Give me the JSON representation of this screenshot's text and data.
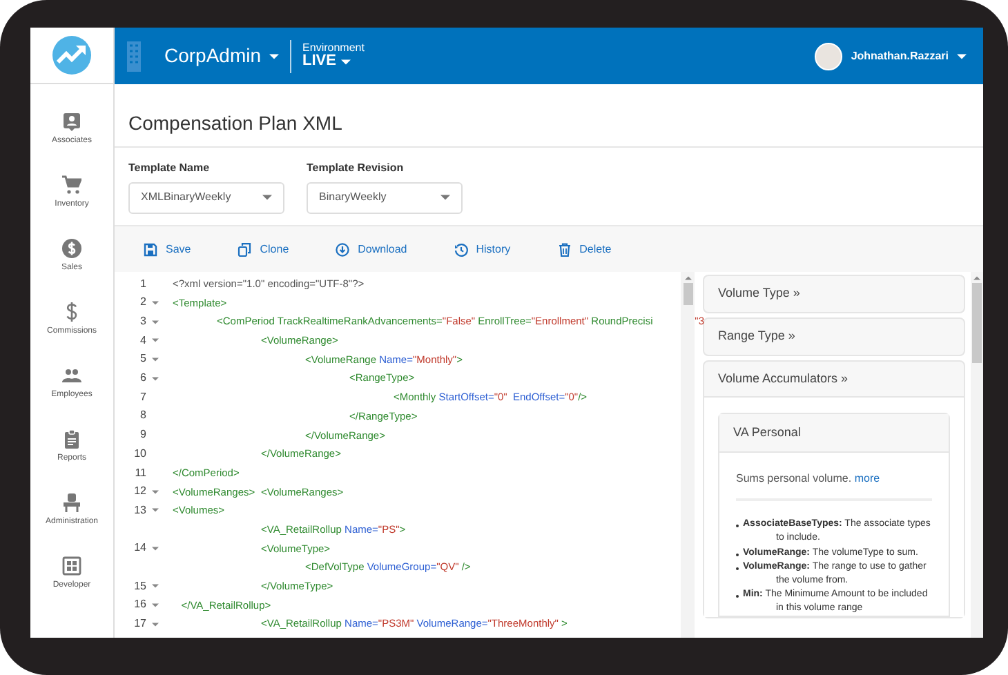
{
  "header": {
    "app_name": "CorpAdmin",
    "environment_label": "Environment",
    "environment": "LIVE",
    "user_name": "Johnathan.Razzari"
  },
  "sidebar": {
    "items": [
      {
        "label": "Associates"
      },
      {
        "label": "Inventory"
      },
      {
        "label": "Sales"
      },
      {
        "label": "Commissions"
      },
      {
        "label": "Employees"
      },
      {
        "label": "Reports"
      },
      {
        "label": "Administration"
      },
      {
        "label": "Developer"
      }
    ]
  },
  "page": {
    "title": "Compensation Plan XML",
    "fields": [
      {
        "label": "Template Name",
        "value": "XMLBinaryWeekly"
      },
      {
        "label": "Template Revision",
        "value": "BinaryWeekly"
      }
    ],
    "toolbar": [
      {
        "label": "Save"
      },
      {
        "label": "Clone"
      },
      {
        "label": "Download"
      },
      {
        "label": "History"
      },
      {
        "label": "Delete"
      }
    ]
  },
  "editor": {
    "lines": [
      {
        "number": "1",
        "foldable": false,
        "tokens": [
          {
            "kind": "plain",
            "text": "<?xml version=\"1.0\" encoding=\"UTF-8\"?>"
          }
        ]
      },
      {
        "number": "2",
        "foldable": true,
        "tokens": [
          {
            "kind": "tag",
            "text": "<Template>"
          }
        ]
      },
      {
        "number": "3",
        "foldable": true,
        "tokens": [
          {
            "kind": "tag",
            "text": "\t<ComPeriod TrackRealtimeRankAdvancements="
          },
          {
            "kind": "value",
            "text": "\"False\""
          },
          {
            "kind": "tag",
            "text": " EnrollTree="
          },
          {
            "kind": "value",
            "text": "\"Enrollment\""
          },
          {
            "kind": "tag",
            "text": " RoundPrecisi"
          },
          {
            "kind": "overflow",
            "text": "\"3"
          }
        ]
      },
      {
        "number": "4",
        "foldable": true,
        "tokens": [
          {
            "kind": "tag",
            "text": "\t\t<VolumeRange>"
          }
        ]
      },
      {
        "number": "5",
        "foldable": true,
        "tokens": [
          {
            "kind": "tag",
            "text": "\t\t\t<VolumeRange "
          },
          {
            "kind": "attr",
            "text": "Name="
          },
          {
            "kind": "value",
            "text": "\"Monthly\""
          },
          {
            "kind": "tag",
            "text": ">"
          }
        ]
      },
      {
        "number": "6",
        "foldable": true,
        "tokens": [
          {
            "kind": "tag",
            "text": "\t\t\t\t<RangeType>"
          }
        ]
      },
      {
        "number": "7",
        "foldable": false,
        "tokens": [
          {
            "kind": "tag",
            "text": "\t\t\t\t\t<Monthly "
          },
          {
            "kind": "attr",
            "text": "StartOffset="
          },
          {
            "kind": "value",
            "text": "\"0\""
          },
          {
            "kind": "attr",
            "text": "  EndOffset="
          },
          {
            "kind": "value",
            "text": "\"0\""
          },
          {
            "kind": "tag",
            "text": "/>"
          }
        ]
      },
      {
        "number": "8",
        "foldable": false,
        "tokens": [
          {
            "kind": "tag",
            "text": "\t\t\t\t</RangeType>"
          }
        ]
      },
      {
        "number": "9",
        "foldable": false,
        "tokens": [
          {
            "kind": "tag",
            "text": "\t\t\t</VolumeRange>"
          }
        ]
      },
      {
        "number": "10",
        "foldable": false,
        "tokens": [
          {
            "kind": "tag",
            "text": "\t\t</VolumeRange>"
          }
        ]
      },
      {
        "number": "11",
        "foldable": false,
        "tokens": [
          {
            "kind": "tag",
            "text": "</ComPeriod>"
          }
        ]
      },
      {
        "number": "12",
        "foldable": true,
        "tokens": [
          {
            "kind": "tag",
            "text": "<VolumeRanges>\t<VolumeRanges>"
          }
        ]
      },
      {
        "number": "13",
        "foldable": true,
        "tokens": [
          {
            "kind": "tag",
            "text": "<Volumes>"
          }
        ]
      },
      {
        "foldable": false,
        "tokens": [
          {
            "kind": "tag",
            "text": "\t\t<VA_RetailRollup "
          },
          {
            "kind": "attr",
            "text": "Name="
          },
          {
            "kind": "value",
            "text": "\"PS\""
          },
          {
            "kind": "tag",
            "text": ">"
          }
        ]
      },
      {
        "number": "14",
        "foldable": true,
        "tokens": [
          {
            "kind": "tag",
            "text": "\t\t<VolumeType>"
          }
        ]
      },
      {
        "foldable": false,
        "tokens": [
          {
            "kind": "tag",
            "text": "\t\t\t<DefVolType "
          },
          {
            "kind": "attr",
            "text": "VolumeGroup="
          },
          {
            "kind": "value",
            "text": "\"QV\""
          },
          {
            "kind": "tag",
            "text": " />"
          }
        ]
      },
      {
        "number": "15",
        "foldable": true,
        "tokens": [
          {
            "kind": "tag",
            "text": "\t\t</VolumeType>"
          }
        ]
      },
      {
        "number": "16",
        "foldable": true,
        "tokens": [
          {
            "kind": "tag",
            "text": "   </VA_RetailRollup>"
          }
        ]
      },
      {
        "number": "17",
        "foldable": true,
        "tokens": [
          {
            "kind": "tag",
            "text": "\t\t<VA_RetailRollup "
          },
          {
            "kind": "attr",
            "text": "Name="
          },
          {
            "kind": "value",
            "text": "\"PS3M\""
          },
          {
            "kind": "attr",
            "text": " VolumeRange="
          },
          {
            "kind": "value",
            "text": "\"ThreeMonthly\""
          },
          {
            "kind": "tag",
            "text": " >"
          }
        ]
      }
    ]
  },
  "reference": {
    "sections": [
      {
        "title": "Volume Type »",
        "expanded": false
      },
      {
        "title": "Range Type »",
        "expanded": false
      },
      {
        "title": "Volume Accumulators »",
        "expanded": true,
        "card": {
          "title": "VA Personal",
          "description": "Sums personal volume.",
          "link": "more",
          "items": [
            "**AssociateBaseTypes:** The associate types to include.",
            "**VolumeRange:** The volumeType to sum.",
            "**VolumeRange:** The range to use to gather the volume from.",
            "**Min:** The Minimume Amount to be included in this volume range"
          ]
        }
      }
    ]
  }
}
